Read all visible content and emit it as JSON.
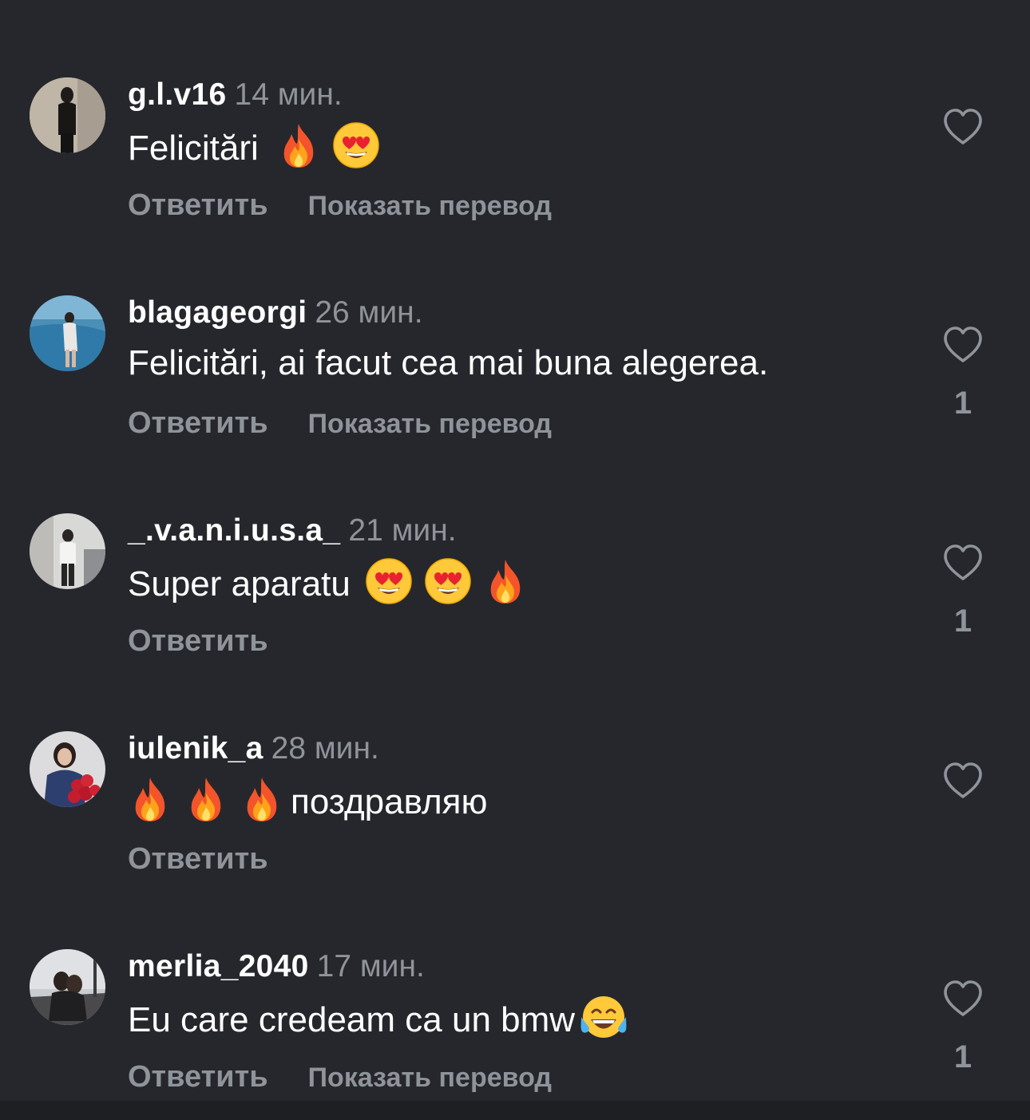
{
  "colors": {
    "background": "#25272c",
    "muted": "#8f939a",
    "text": "#ffffff"
  },
  "comments": [
    {
      "username": "g.l.v16",
      "time": "14 мин.",
      "text": "Felicitări",
      "emojis": [
        "fire-emoji",
        "heart-eyes-emoji"
      ],
      "reply_label": "Ответить",
      "translate_label": "Показать перевод",
      "likes": ""
    },
    {
      "username": "blagageorgi",
      "time": "26 мин.",
      "text": "Felicitări, ai facut cea mai buna alegerea.",
      "emojis": [],
      "reply_label": "Ответить",
      "translate_label": "Показать перевод",
      "likes": "1"
    },
    {
      "username": "_.v.a.n.i.u.s.a_",
      "time": "21 мин.",
      "text": "Super aparatu",
      "emojis": [
        "heart-eyes-emoji",
        "heart-eyes-emoji",
        "fire-emoji"
      ],
      "reply_label": "Ответить",
      "translate_label": "",
      "likes": "1"
    },
    {
      "username": "iulenik_a",
      "time": "28 мин.",
      "text": "поздравляю",
      "emojis": [
        "fire-emoji",
        "fire-emoji",
        "fire-emoji"
      ],
      "reply_label": "Ответить",
      "translate_label": "",
      "likes": ""
    },
    {
      "username": "merlia_2040",
      "time": "17 мин.",
      "text": "Eu care credeam ca un bmw",
      "emojis": [
        "tears-of-joy-emoji"
      ],
      "reply_label": "Ответить",
      "translate_label": "Показать перевод",
      "likes": "1"
    }
  ]
}
